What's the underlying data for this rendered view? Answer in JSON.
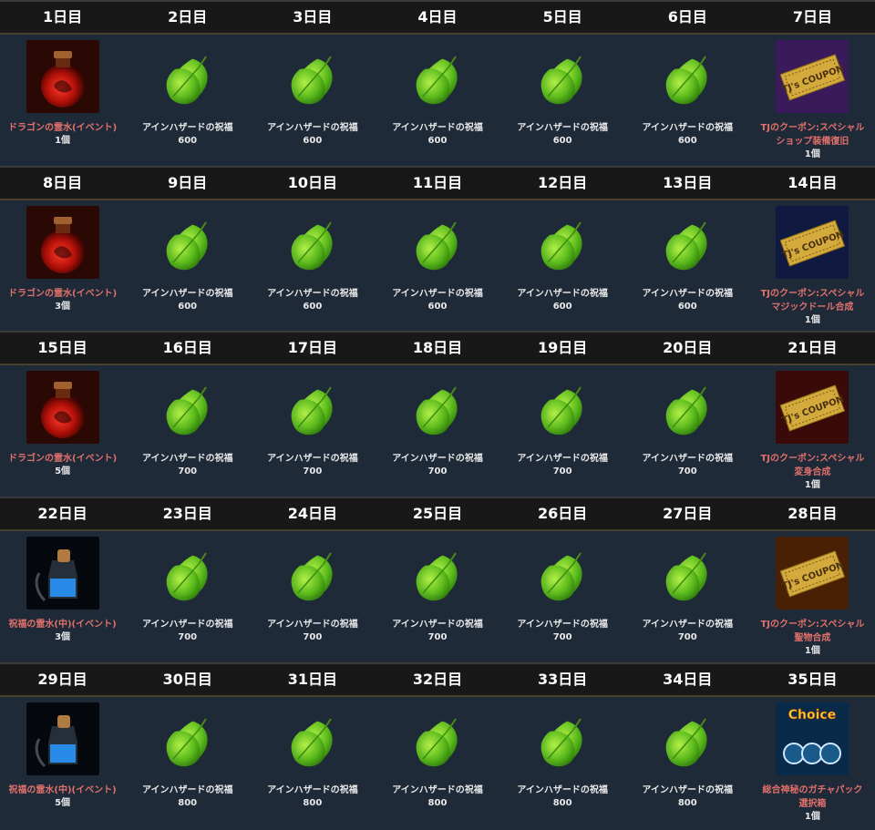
{
  "weeks": [
    {
      "days": [
        {
          "label": "1日目",
          "item": "ドラゴンの霊水(イベント)",
          "qty": "1個",
          "icon": "red-potion",
          "highlight": true
        },
        {
          "label": "2日目",
          "item": "アインハザードの祝福",
          "qty": "600",
          "icon": "green-leaf",
          "highlight": false
        },
        {
          "label": "3日目",
          "item": "アインハザードの祝福",
          "qty": "600",
          "icon": "green-leaf",
          "highlight": false
        },
        {
          "label": "4日目",
          "item": "アインハザードの祝福",
          "qty": "600",
          "icon": "green-leaf",
          "highlight": false
        },
        {
          "label": "5日目",
          "item": "アインハザードの祝福",
          "qty": "600",
          "icon": "green-leaf",
          "highlight": false
        },
        {
          "label": "6日目",
          "item": "アインハザードの祝福",
          "qty": "600",
          "icon": "green-leaf",
          "highlight": false
        },
        {
          "label": "7日目",
          "item": "TJのクーポン:スペシャル",
          "item2": "ショップ装備復旧",
          "qty": "1個",
          "icon": "coupon-purple",
          "highlight": true
        }
      ]
    },
    {
      "days": [
        {
          "label": "8日目",
          "item": "ドラゴンの霊水(イベント)",
          "qty": "3個",
          "icon": "red-potion",
          "highlight": true
        },
        {
          "label": "9日目",
          "item": "アインハザードの祝福",
          "qty": "600",
          "icon": "green-leaf",
          "highlight": false
        },
        {
          "label": "10日目",
          "item": "アインハザードの祝福",
          "qty": "600",
          "icon": "green-leaf",
          "highlight": false
        },
        {
          "label": "11日目",
          "item": "アインハザードの祝福",
          "qty": "600",
          "icon": "green-leaf",
          "highlight": false
        },
        {
          "label": "12日目",
          "item": "アインハザードの祝福",
          "qty": "600",
          "icon": "green-leaf",
          "highlight": false
        },
        {
          "label": "13日目",
          "item": "アインハザードの祝福",
          "qty": "600",
          "icon": "green-leaf",
          "highlight": false
        },
        {
          "label": "14日目",
          "item": "TJのクーポン:スペシャル",
          "item2": "マジックドール合成",
          "qty": "1個",
          "icon": "coupon-blue",
          "highlight": true
        }
      ]
    },
    {
      "days": [
        {
          "label": "15日目",
          "item": "ドラゴンの霊水(イベント)",
          "qty": "5個",
          "icon": "red-potion",
          "highlight": true
        },
        {
          "label": "16日目",
          "item": "アインハザードの祝福",
          "qty": "700",
          "icon": "green-leaf",
          "highlight": false
        },
        {
          "label": "17日目",
          "item": "アインハザードの祝福",
          "qty": "700",
          "icon": "green-leaf",
          "highlight": false
        },
        {
          "label": "18日目",
          "item": "アインハザードの祝福",
          "qty": "700",
          "icon": "green-leaf",
          "highlight": false
        },
        {
          "label": "19日目",
          "item": "アインハザードの祝福",
          "qty": "700",
          "icon": "green-leaf",
          "highlight": false
        },
        {
          "label": "20日目",
          "item": "アインハザードの祝福",
          "qty": "700",
          "icon": "green-leaf",
          "highlight": false
        },
        {
          "label": "21日目",
          "item": "TJのクーポン:スペシャル",
          "item2": "変身合成",
          "qty": "1個",
          "icon": "coupon-red",
          "highlight": true
        }
      ]
    },
    {
      "days": [
        {
          "label": "22日目",
          "item": "祝福の霊水(中)(イベント)",
          "qty": "3個",
          "icon": "blue-potion",
          "highlight": true
        },
        {
          "label": "23日目",
          "item": "アインハザードの祝福",
          "qty": "700",
          "icon": "green-leaf",
          "highlight": false
        },
        {
          "label": "24日目",
          "item": "アインハザードの祝福",
          "qty": "700",
          "icon": "green-leaf",
          "highlight": false
        },
        {
          "label": "25日目",
          "item": "アインハザードの祝福",
          "qty": "700",
          "icon": "green-leaf",
          "highlight": false
        },
        {
          "label": "26日目",
          "item": "アインハザードの祝福",
          "qty": "700",
          "icon": "green-leaf",
          "highlight": false
        },
        {
          "label": "27日目",
          "item": "アインハザードの祝福",
          "qty": "700",
          "icon": "green-leaf",
          "highlight": false
        },
        {
          "label": "28日目",
          "item": "TJのクーポン:スペシャル",
          "item2": "聖物合成",
          "qty": "1個",
          "icon": "coupon-orange",
          "highlight": true
        }
      ]
    },
    {
      "days": [
        {
          "label": "29日目",
          "item": "祝福の霊水(中)(イベント)",
          "qty": "5個",
          "icon": "blue-potion",
          "highlight": true
        },
        {
          "label": "30日目",
          "item": "アインハザードの祝福",
          "qty": "800",
          "icon": "green-leaf",
          "highlight": false
        },
        {
          "label": "31日目",
          "item": "アインハザードの祝福",
          "qty": "800",
          "icon": "green-leaf",
          "highlight": false
        },
        {
          "label": "32日目",
          "item": "アインハザードの祝福",
          "qty": "800",
          "icon": "green-leaf",
          "highlight": false
        },
        {
          "label": "33日目",
          "item": "アインハザードの祝福",
          "qty": "800",
          "icon": "green-leaf",
          "highlight": false
        },
        {
          "label": "34日目",
          "item": "アインハザードの祝福",
          "qty": "800",
          "icon": "green-leaf",
          "highlight": false
        },
        {
          "label": "35日目",
          "item": "総合神秘のガチャパック",
          "item2": "選択箱",
          "qty": "1個",
          "icon": "choice-box",
          "highlight": true,
          "icon_text": "Choice"
        }
      ]
    }
  ],
  "coupon_text": "TJ's COUPON",
  "colors": {
    "background": "#1f2a39",
    "header": "#181818",
    "highlight_text": "#e0706a",
    "normal_text": "#e8e8e8"
  }
}
